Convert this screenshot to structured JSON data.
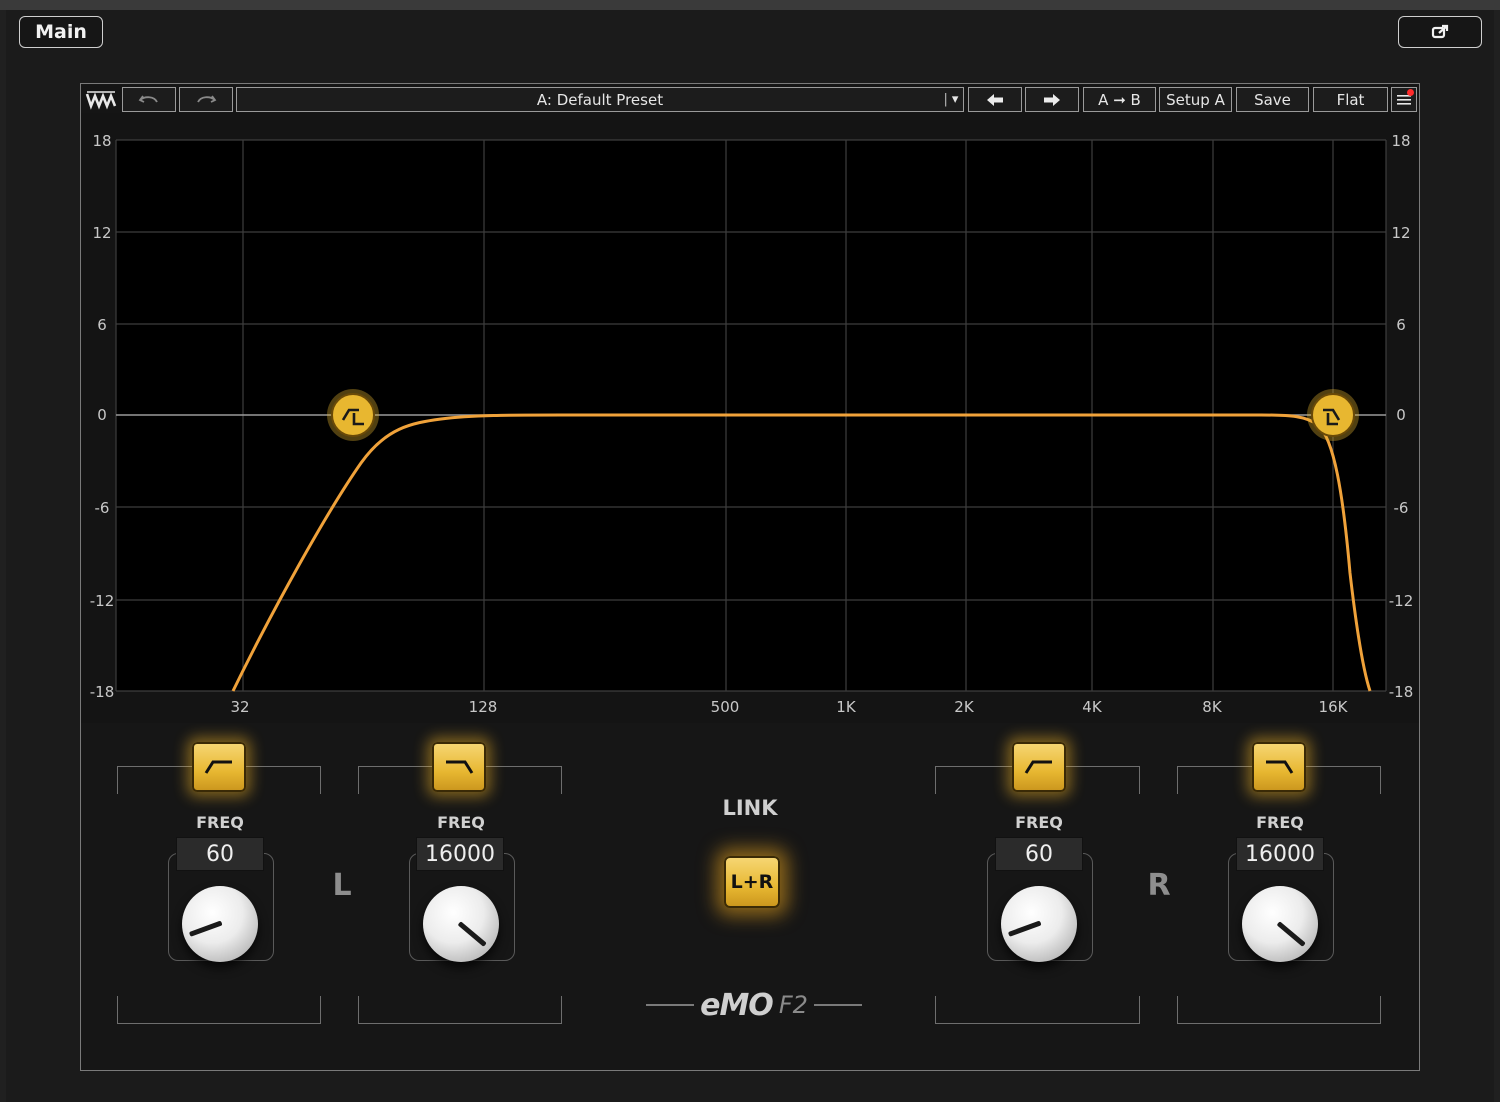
{
  "host": {
    "tab_label": "Main",
    "popout_icon": "popout-icon"
  },
  "toolbar": {
    "logo_icon": "waves-logo-icon",
    "undo_icon": "undo-icon",
    "redo_icon": "redo-icon",
    "preset_name": "A: Default Preset",
    "preset_dropdown_glyph": "▾",
    "prev_preset_glyph": "🡐",
    "next_preset_glyph": "🡒",
    "ab_label": "A ➞ B",
    "setup_label": "Setup A",
    "save_label": "Save",
    "flat_label": "Flat",
    "menu_icon": "menu-icon"
  },
  "graph": {
    "y_ticks": [
      "18",
      "12",
      "6",
      "0",
      "-6",
      "-12",
      "-18"
    ],
    "x_ticks": [
      "32",
      "128",
      "500",
      "1K",
      "2K",
      "4K",
      "8K",
      "16K"
    ],
    "curve_color": "#f0a23a",
    "handle_color": "#e8b730"
  },
  "controls": {
    "left_channel_label": "L",
    "right_channel_label": "R",
    "freq_label": "FREQ",
    "bands": [
      {
        "type": "high-pass",
        "freq": "60"
      },
      {
        "type": "low-pass",
        "freq": "16000"
      },
      {
        "type": "high-pass",
        "freq": "60"
      },
      {
        "type": "low-pass",
        "freq": "16000"
      }
    ],
    "link_label": "LINK",
    "link_button": "L+R",
    "brand_mark": "eMO",
    "brand_sub": "F2"
  }
}
